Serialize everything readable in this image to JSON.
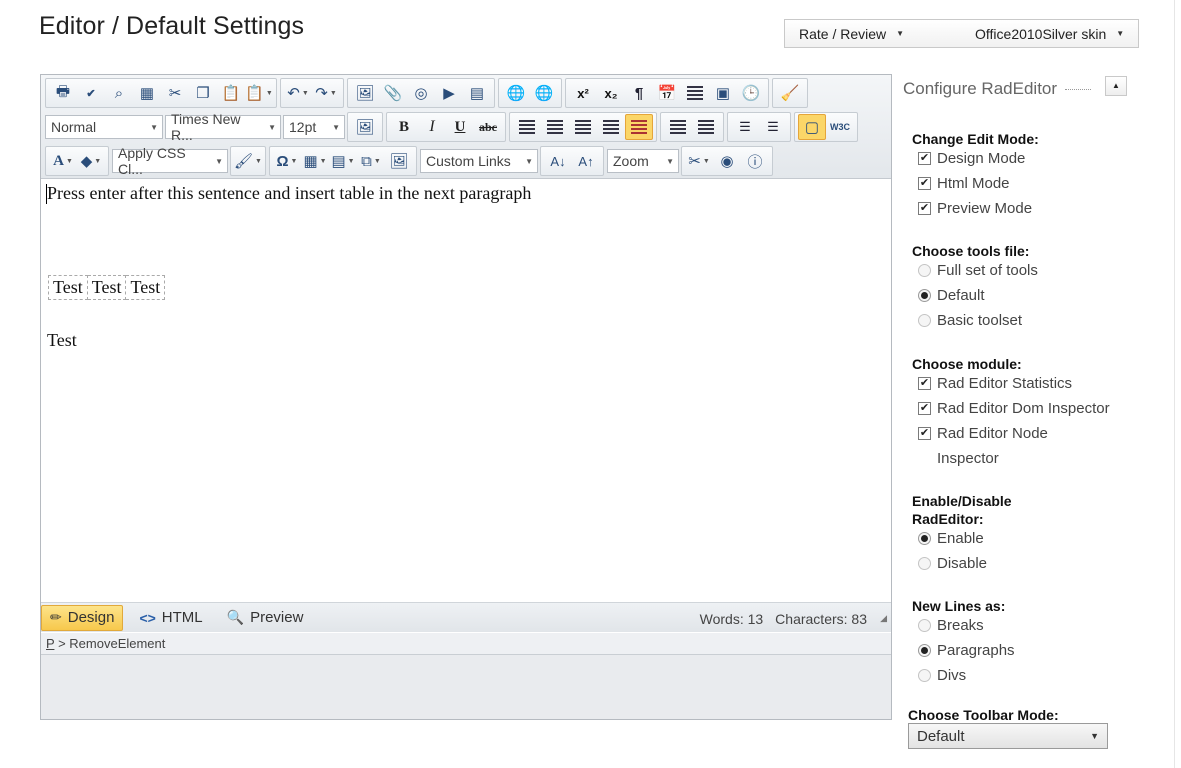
{
  "page": {
    "title": "Editor / Default Settings"
  },
  "topbar": {
    "rate_label": "Rate / Review",
    "skin_label": "Office2010Silver skin"
  },
  "toolbar": {
    "format_block": "Normal",
    "font_name": "Times New R...",
    "font_size": "12pt",
    "css_class": "Apply CSS Cl...",
    "custom_links": "Custom Links",
    "zoom": "Zoom",
    "superscript": "x²",
    "subscript": "x₂",
    "bold": "B",
    "italic": "I",
    "underline": "U",
    "strike": "abc",
    "omega": "Ω",
    "font_color": "A",
    "w3c": "W3C"
  },
  "content": {
    "paragraph1": "Press enter after this sentence and insert table in the next paragraph",
    "table_cells": [
      "Test",
      "Test",
      "Test"
    ],
    "paragraph3": "Test"
  },
  "modes": {
    "design": "Design",
    "html": "HTML",
    "preview": "Preview"
  },
  "stats": {
    "words": "Words: 13",
    "characters": "Characters: 83"
  },
  "path": {
    "element": "P",
    "separator": ">",
    "action": "RemoveElement"
  },
  "config": {
    "title": "Configure RadEditor",
    "edit_mode": {
      "title": "Change Edit Mode:",
      "options": [
        {
          "label": "Design Mode",
          "checked": true
        },
        {
          "label": "Html Mode",
          "checked": true
        },
        {
          "label": "Preview Mode",
          "checked": true
        }
      ]
    },
    "tools_file": {
      "title": "Choose tools file:",
      "options": [
        {
          "label": "Full set of tools",
          "selected": false
        },
        {
          "label": "Default",
          "selected": true
        },
        {
          "label": "Basic toolset",
          "selected": false
        }
      ]
    },
    "module": {
      "title": "Choose module:",
      "options": [
        {
          "label": "Rad Editor Statistics",
          "checked": true
        },
        {
          "label": "Rad Editor Dom Inspector",
          "checked": true
        },
        {
          "label": "Rad Editor Node",
          "checked": true
        }
      ],
      "wrap_text": "Inspector"
    },
    "enable": {
      "title_line1": "Enable/Disable",
      "title_line2": "RadEditor:",
      "options": [
        {
          "label": "Enable",
          "selected": true
        },
        {
          "label": "Disable",
          "selected": false
        }
      ]
    },
    "new_lines": {
      "title": "New Lines as:",
      "options": [
        {
          "label": "Breaks",
          "selected": false
        },
        {
          "label": "Paragraphs",
          "selected": true
        },
        {
          "label": "Divs",
          "selected": false
        }
      ]
    },
    "toolbar_mode": {
      "title": "Choose Toolbar Mode:",
      "value": "Default"
    }
  }
}
